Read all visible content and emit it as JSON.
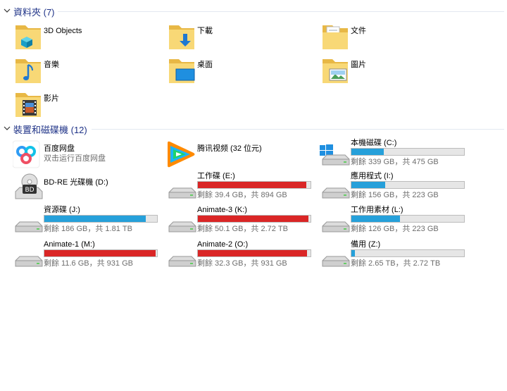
{
  "folders_group": {
    "title": "資料夾 (7)"
  },
  "folders": [
    {
      "name": "3D Objects",
      "icon": "3d-objects-icon"
    },
    {
      "name": "下載",
      "icon": "downloads-icon"
    },
    {
      "name": "文件",
      "icon": "documents-icon"
    },
    {
      "name": "音樂",
      "icon": "music-icon"
    },
    {
      "name": "桌面",
      "icon": "desktop-icon"
    },
    {
      "name": "圖片",
      "icon": "pictures-icon"
    },
    {
      "name": "影片",
      "icon": "videos-icon"
    }
  ],
  "devices_group": {
    "title": "裝置和磁碟機 (12)"
  },
  "apps": [
    {
      "name": "百度网盘",
      "sub": "双击运行百度网盘",
      "icon": "baidu-netdisk-icon"
    },
    {
      "name": "腾讯视频 (32 位元)",
      "icon": "tencent-video-icon"
    }
  ],
  "drives": [
    {
      "name": "本機磁碟 (C:)",
      "free": "剩餘 339 GB，共 475 GB",
      "used_fraction": 0.29,
      "bar_color": "#26a0da",
      "icon": "windows-drive-icon"
    },
    {
      "name": "BD-RE 光碟機 (D:)",
      "icon": "bd-drive-icon"
    },
    {
      "name": "工作碟 (E:)",
      "free": "剩餘 39.4 GB，共 894 GB",
      "used_fraction": 0.96,
      "bar_color": "#da2626",
      "icon": "hard-drive-icon"
    },
    {
      "name": "應用程式 (I:)",
      "free": "剩餘 156 GB，共 223 GB",
      "used_fraction": 0.3,
      "bar_color": "#26a0da",
      "icon": "hard-drive-icon"
    },
    {
      "name": "資源碟 (J:)",
      "free": "剩餘 186 GB，共 1.81 TB",
      "used_fraction": 0.9,
      "bar_color": "#26a0da",
      "icon": "hard-drive-icon"
    },
    {
      "name": "Animate-3 (K:)",
      "free": "剩餘 50.1 GB，共 2.72 TB",
      "used_fraction": 0.98,
      "bar_color": "#da2626",
      "icon": "hard-drive-icon"
    },
    {
      "name": "工作用素材 (L:)",
      "free": "剩餘 126 GB，共 223 GB",
      "used_fraction": 0.43,
      "bar_color": "#26a0da",
      "icon": "hard-drive-icon"
    },
    {
      "name": "Animate-1 (M:)",
      "free": "剩餘 11.6 GB，共 931 GB",
      "used_fraction": 0.99,
      "bar_color": "#da2626",
      "icon": "hard-drive-icon"
    },
    {
      "name": "Animate-2 (O:)",
      "free": "剩餘 32.3 GB，共 931 GB",
      "used_fraction": 0.97,
      "bar_color": "#da2626",
      "icon": "hard-drive-icon"
    },
    {
      "name": "備用 (Z:)",
      "free": "剩餘 2.65 TB，共 2.72 TB",
      "used_fraction": 0.03,
      "bar_color": "#26a0da",
      "icon": "hard-drive-icon"
    }
  ]
}
